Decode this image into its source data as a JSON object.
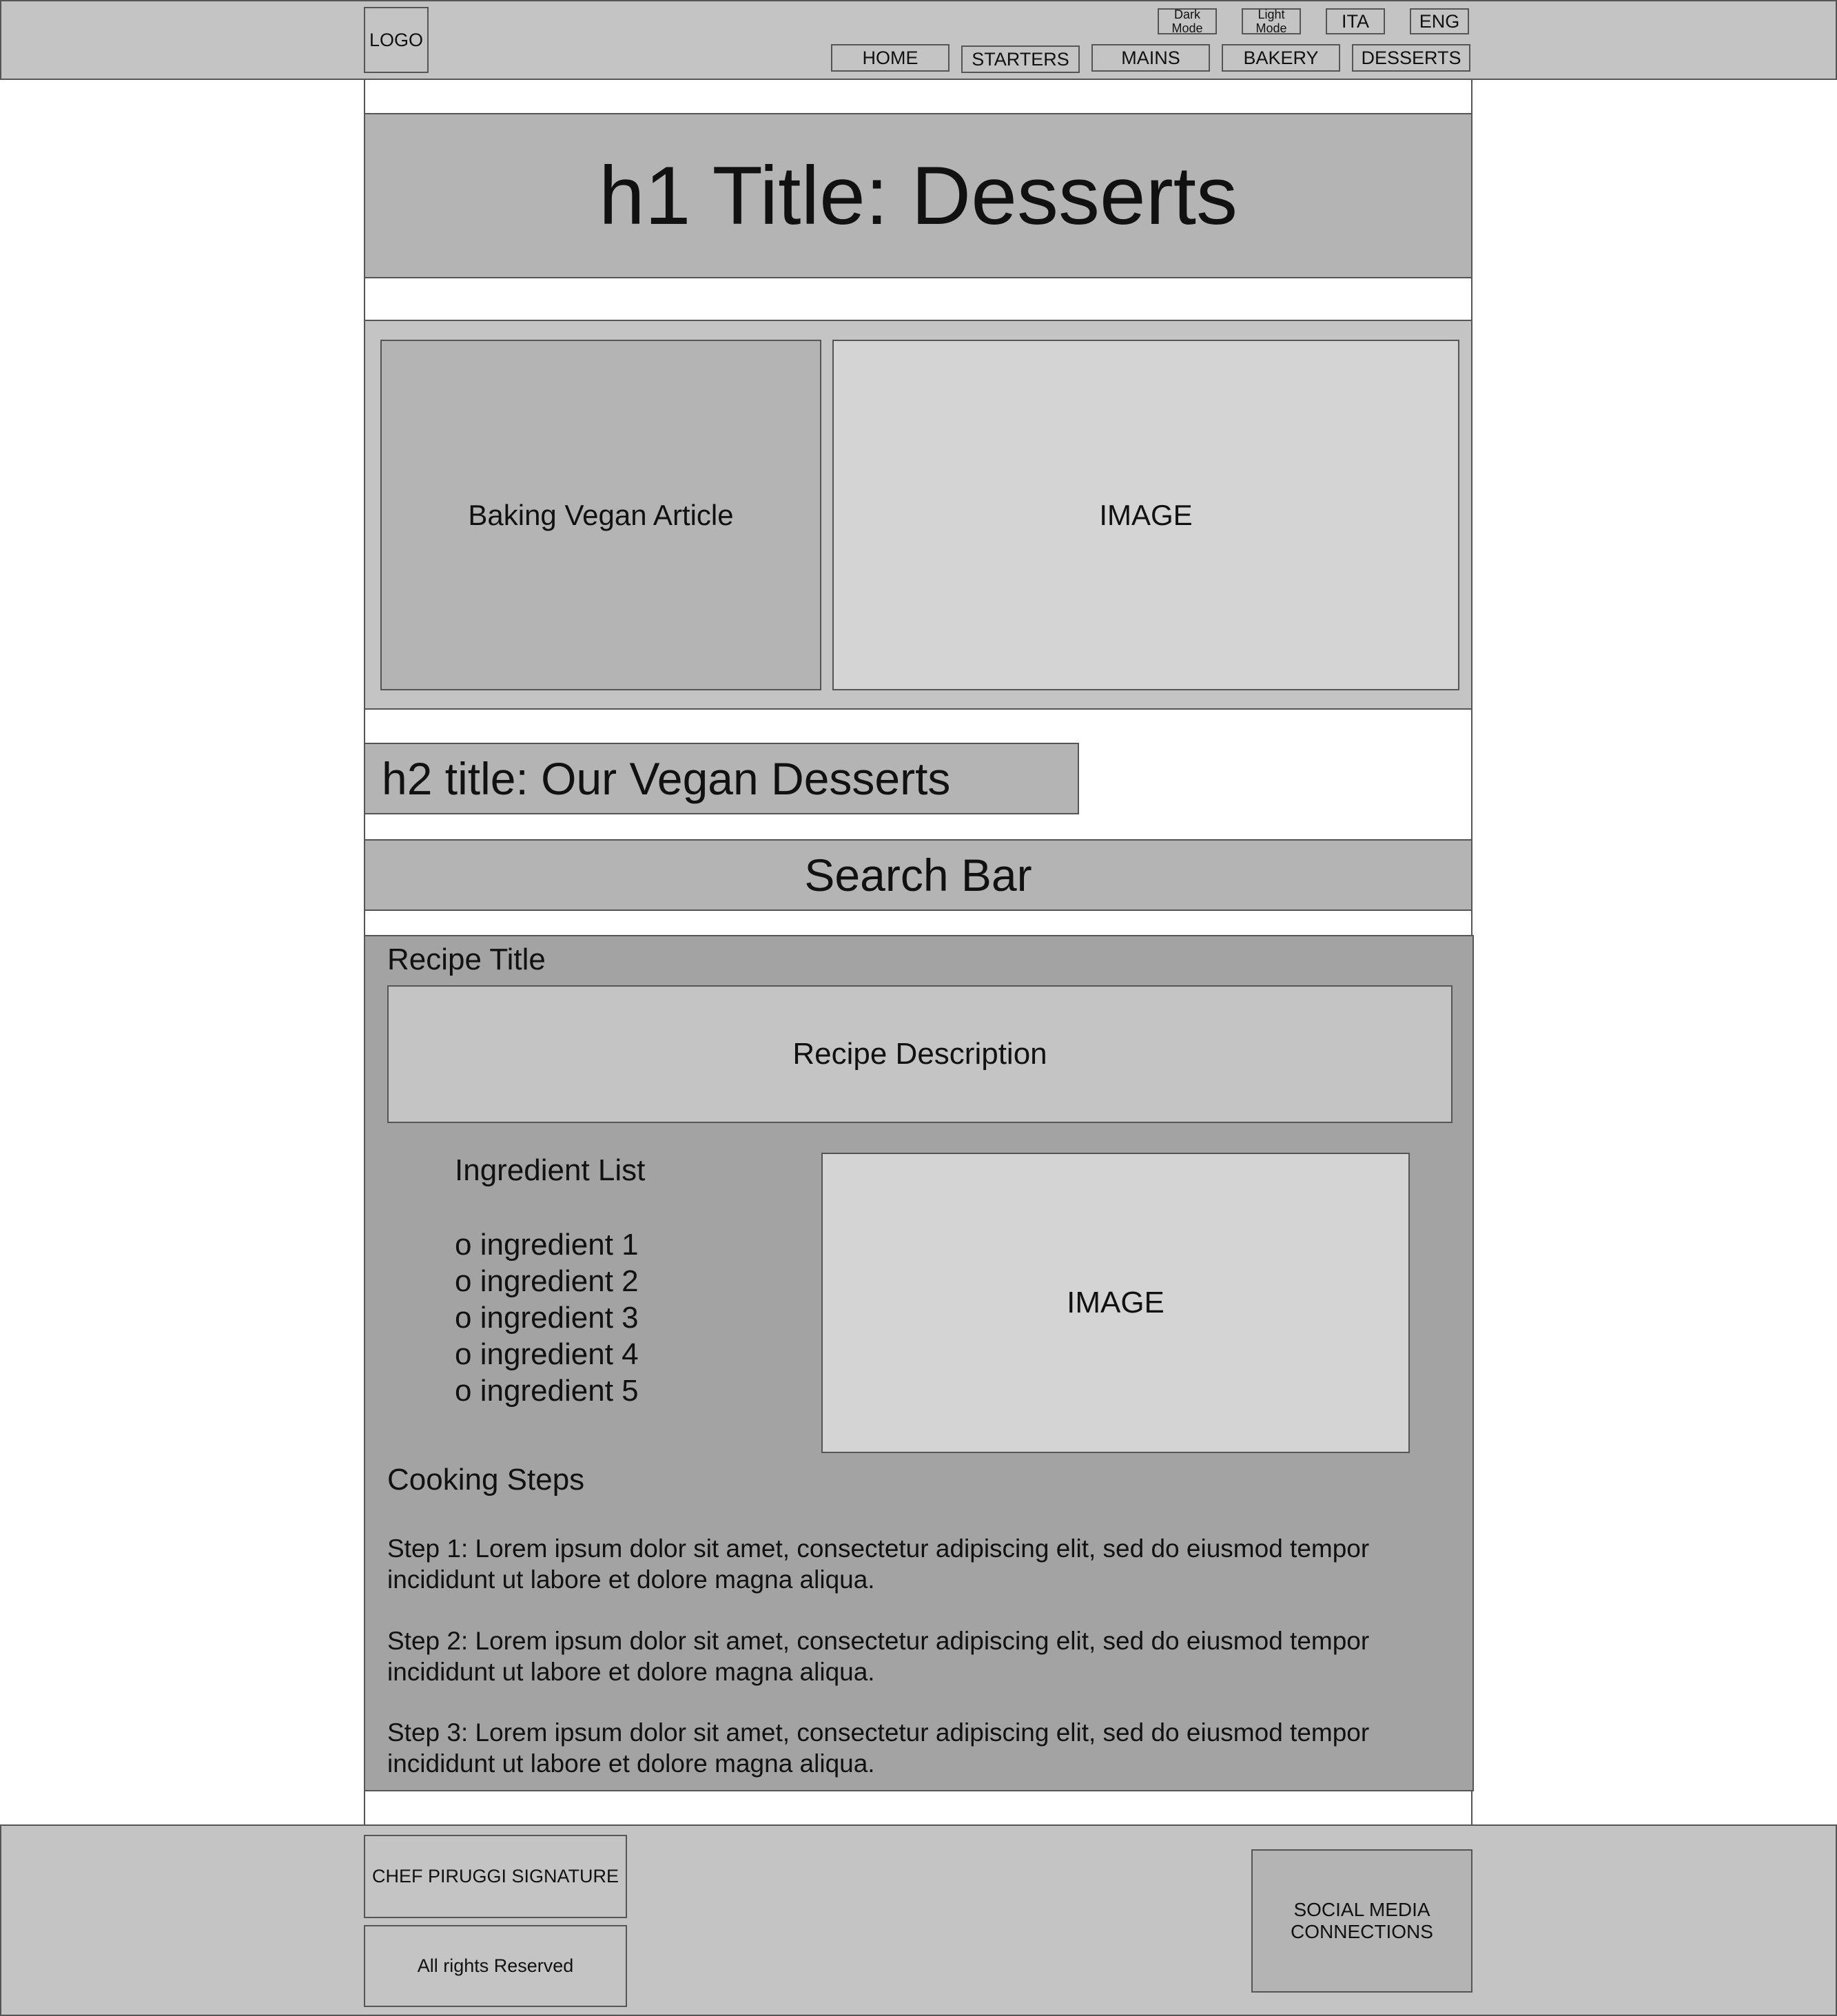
{
  "header": {
    "logo": "LOGO",
    "top_buttons": [
      {
        "line1": "Dark",
        "line2": "Mode"
      },
      {
        "line1": "Light",
        "line2": "Mode"
      }
    ],
    "lang_buttons": [
      "ITA",
      "ENG"
    ],
    "nav": [
      "HOME",
      "STARTERS",
      "MAINS",
      "BAKERY",
      "DESSERTS"
    ]
  },
  "hero": {
    "title": "h1 Title: Desserts"
  },
  "feature": {
    "article": "Baking Vegan Article",
    "image": "IMAGE"
  },
  "section": {
    "h2": "h2 title: Our Vegan Desserts",
    "search": "Search Bar"
  },
  "recipe": {
    "title": "Recipe Title",
    "description": "Recipe Description",
    "ingredients_title": "Ingredient List",
    "ingredients": [
      "o ingredient 1",
      "o ingredient 2",
      "o ingredient 3",
      "o ingredient 4",
      "o ingredient 5"
    ],
    "image": "IMAGE",
    "steps_title": "Cooking Steps",
    "steps": [
      "Step 1: Lorem ipsum dolor sit amet, consectetur adipiscing elit, sed do eiusmod tempor incididunt ut labore et dolore magna aliqua.",
      "Step 2: Lorem ipsum dolor sit amet, consectetur adipiscing elit, sed do eiusmod tempor incididunt ut labore et dolore magna aliqua.",
      "Step 3: Lorem ipsum dolor sit amet, consectetur adipiscing elit, sed do eiusmod tempor incididunt ut labore et dolore magna aliqua."
    ]
  },
  "footer": {
    "signature": "CHEF PIRUGGI SIGNATURE",
    "rights": "All rights Reserved",
    "social": "SOCIAL MEDIA CONNECTIONS"
  }
}
